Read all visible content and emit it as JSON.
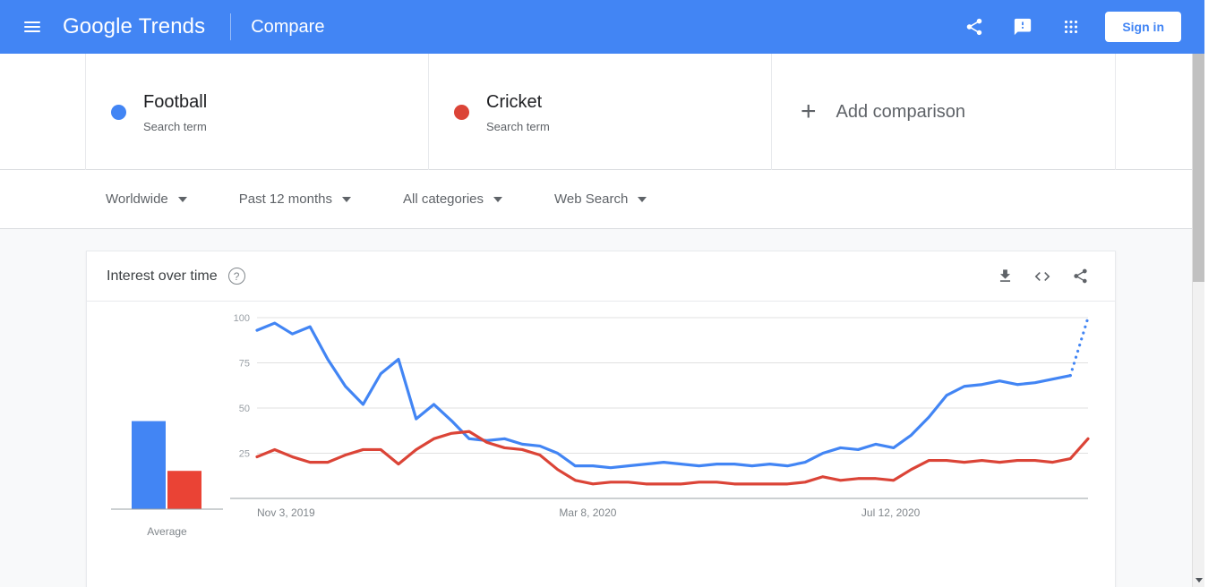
{
  "appbar": {
    "menu_icon": "hamburger-menu-icon",
    "brand": "Google Trends",
    "brand_google": "Google",
    "brand_trends": "Trends",
    "page_mode": "Compare",
    "share_icon": "share-icon",
    "feedback_icon": "feedback-icon",
    "apps_icon": "apps-grid-icon",
    "signin_label": "Sign in",
    "background_color": "#4285F4"
  },
  "compare": {
    "terms": [
      {
        "name": "Football",
        "type": "Search term",
        "color": "#4285F4"
      },
      {
        "name": "Cricket",
        "type": "Search term",
        "color": "#DB4437"
      }
    ],
    "add_comparison": {
      "plus": "+",
      "label": "Add comparison"
    }
  },
  "filters": [
    {
      "label": "Worldwide",
      "name": "location"
    },
    {
      "label": "Past 12 months",
      "name": "time-range"
    },
    {
      "label": "All categories",
      "name": "category"
    },
    {
      "label": "Web Search",
      "name": "search-type"
    }
  ],
  "card": {
    "title": "Interest over time",
    "help_icon": "help-question-icon",
    "help_glyph": "?",
    "download_icon": "download-icon",
    "embed_icon": "embed-code-icon",
    "share_icon": "share-icon"
  },
  "chart_data": {
    "type": "line",
    "title": "Interest over time",
    "xlabel": "",
    "ylabel": "",
    "ylim": [
      0,
      100
    ],
    "yticks": [
      100,
      75,
      50,
      25
    ],
    "grid": true,
    "legend_position": "top",
    "xticks": [
      "Nov 3, 2019",
      "Mar 8, 2020",
      "Jul 12, 2020"
    ],
    "xtick_positions": [
      0,
      0.3636,
      0.7273
    ],
    "partial_data_dashed_tail": true,
    "series": [
      {
        "name": "Football",
        "color": "#4285F4",
        "values": [
          93,
          97,
          91,
          95,
          77,
          62,
          52,
          69,
          77,
          44,
          52,
          43,
          33,
          32,
          33,
          30,
          29,
          25,
          18,
          18,
          17,
          18,
          19,
          20,
          19,
          18,
          19,
          19,
          18,
          19,
          18,
          20,
          25,
          28,
          27,
          30,
          28,
          35,
          45,
          57,
          62,
          63,
          65,
          63,
          64,
          66,
          68,
          100
        ],
        "dashed_from_index": 46
      },
      {
        "name": "Cricket",
        "color": "#DB4437",
        "values": [
          23,
          27,
          23,
          20,
          20,
          24,
          27,
          27,
          19,
          27,
          33,
          36,
          37,
          31,
          28,
          27,
          24,
          16,
          10,
          8,
          9,
          9,
          8,
          8,
          8,
          9,
          9,
          8,
          8,
          8,
          8,
          9,
          12,
          10,
          11,
          11,
          10,
          16,
          21,
          21,
          20,
          21,
          20,
          21,
          21,
          20,
          22,
          33
        ]
      }
    ],
    "average_bars": {
      "label": "Average",
      "categories": [
        "Football",
        "Cricket"
      ],
      "values": [
        46,
        20
      ],
      "colors": [
        "#4285F4",
        "#EA4335"
      ]
    }
  }
}
